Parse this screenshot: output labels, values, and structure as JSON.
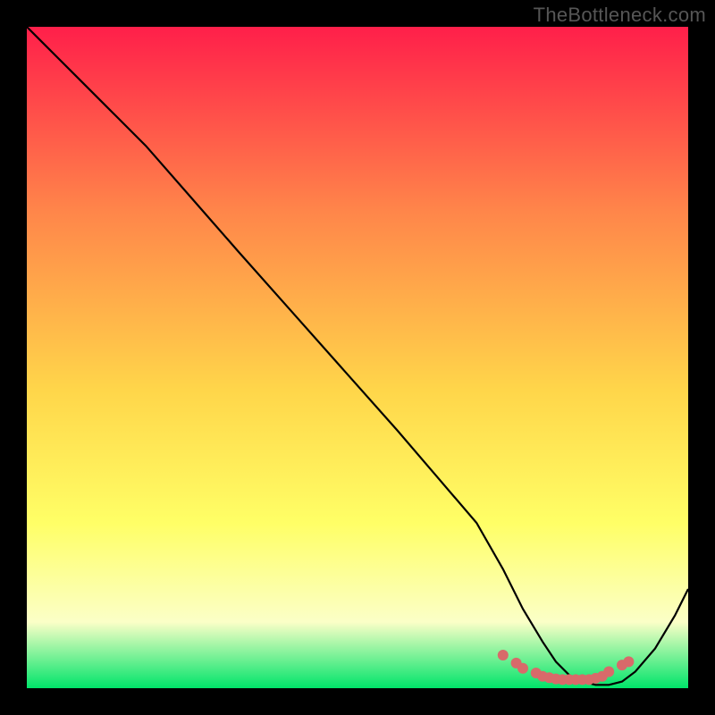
{
  "watermark": "TheBottleneck.com",
  "colors": {
    "gradient_top": "#ff1f4a",
    "gradient_mid_upper": "#ff864a",
    "gradient_mid": "#ffd64a",
    "gradient_mid_lower": "#ffff66",
    "gradient_pale": "#fbffc7",
    "gradient_green": "#00e46a",
    "curve": "#000000",
    "markers": "#d86a6a",
    "bg": "#000000"
  },
  "chart_data": {
    "type": "line",
    "title": "",
    "xlabel": "",
    "ylabel": "",
    "xlim": [
      0,
      100
    ],
    "ylim": [
      0,
      100
    ],
    "series": [
      {
        "name": "bottleneck-curve",
        "x": [
          0,
          2,
          5,
          8,
          12,
          18,
          25,
          32,
          40,
          48,
          56,
          62,
          68,
          72,
          75,
          78,
          80,
          82,
          84,
          86,
          88,
          90,
          92,
          95,
          98,
          100
        ],
        "y": [
          100,
          98,
          95,
          92,
          88,
          82,
          74,
          66,
          57,
          48,
          39,
          32,
          25,
          18,
          12,
          7,
          4,
          2,
          1,
          0.5,
          0.5,
          1,
          2.5,
          6,
          11,
          15
        ]
      }
    ],
    "markers": {
      "name": "sweet-spot",
      "x": [
        72,
        74,
        75,
        77,
        78,
        79,
        80,
        81,
        82,
        83,
        84,
        85,
        86,
        87,
        88,
        90,
        91
      ],
      "y": [
        5.0,
        3.8,
        3.0,
        2.3,
        1.8,
        1.6,
        1.4,
        1.3,
        1.3,
        1.3,
        1.3,
        1.3,
        1.5,
        1.8,
        2.5,
        3.5,
        4.0
      ]
    }
  }
}
